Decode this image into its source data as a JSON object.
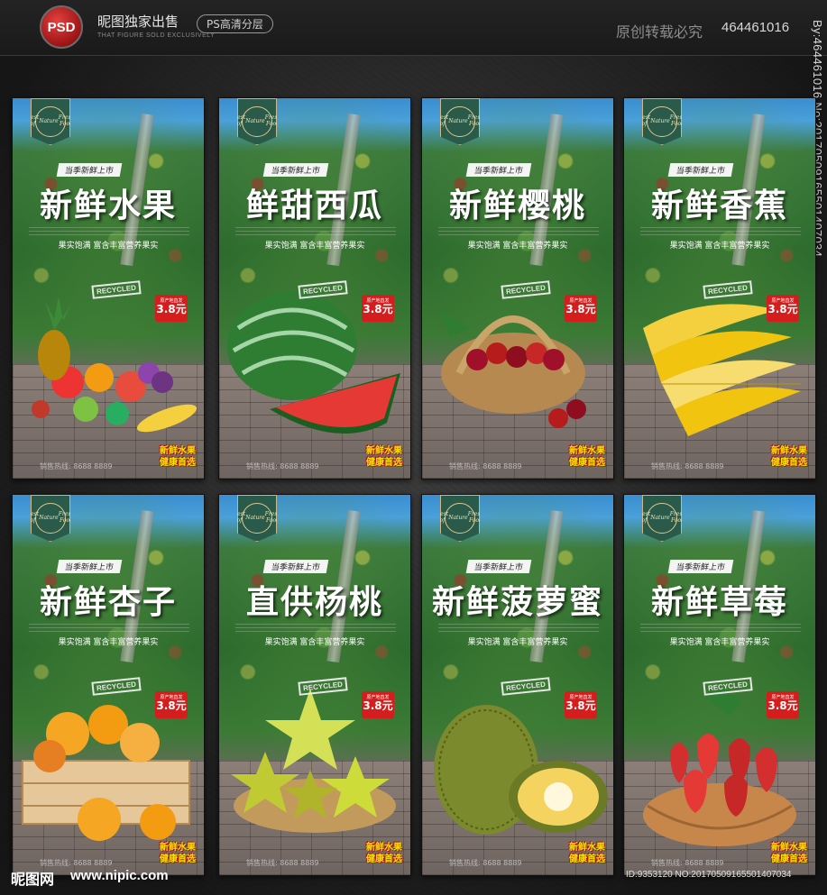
{
  "header": {
    "badge": "PSD",
    "title": "昵图独家出售",
    "subtitle": "THAT FIGURE SOLD EXCLUSIVELY",
    "pill": "PS高清分层",
    "copyright": "原创转载必究",
    "id": "464461016"
  },
  "watermark_vertical": "By:464461016 No:20170509165501407034",
  "footer": {
    "logo": "昵图网",
    "url": "www.nipic.com",
    "id": "ID:9353120 NO:20170509165501407034"
  },
  "common": {
    "badge_line1": "Best of",
    "badge_line2": "Nature",
    "badge_line3": "Fresh Food",
    "tagline": "当季新鲜上市",
    "slogan": "果实饱满  富含丰富营养果实",
    "recycled": "RECYCLED",
    "price_label": "原产地直发",
    "price": "3.8元",
    "corner_line1": "新鲜水果",
    "corner_line2": "健康首选",
    "hotline": "销售热线: 8688 8889"
  },
  "posters": [
    {
      "title": "新鲜水果",
      "fruit": "mixed-fruit"
    },
    {
      "title": "鲜甜西瓜",
      "fruit": "watermelon"
    },
    {
      "title": "新鲜樱桃",
      "fruit": "cherry"
    },
    {
      "title": "新鲜香蕉",
      "fruit": "banana"
    },
    {
      "title": "新鲜杏子",
      "fruit": "apricot"
    },
    {
      "title": "直供杨桃",
      "fruit": "starfruit"
    },
    {
      "title": "新鲜菠萝蜜",
      "fruit": "jackfruit"
    },
    {
      "title": "新鲜草莓",
      "fruit": "strawberry"
    }
  ],
  "colors": {
    "price_tag": "#d41d1d",
    "corner_text": "#f5e500",
    "badge_bg": "#2a5a4a"
  }
}
